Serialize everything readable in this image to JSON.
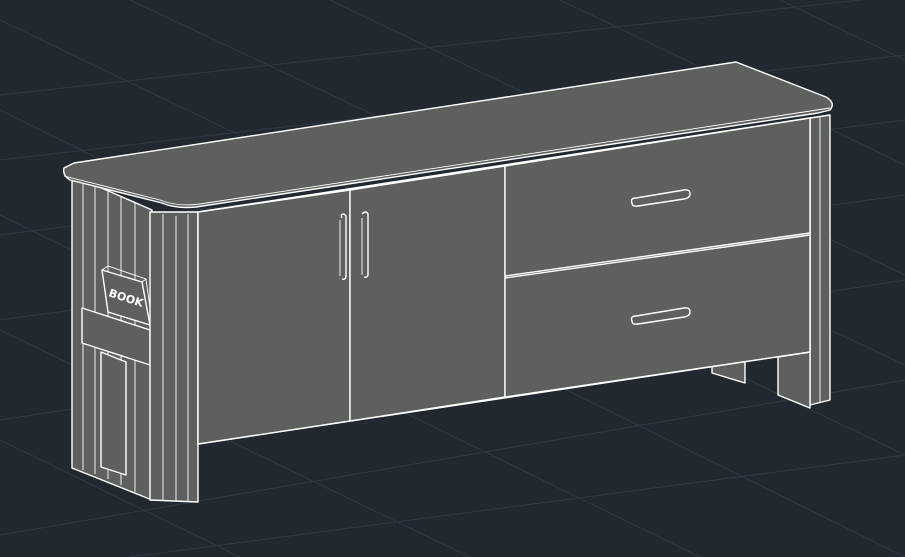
{
  "model_viewport": {
    "background_color": "#212830",
    "grid_color": "#2f3944",
    "linework_color": "#ffffff",
    "surface_color": "#5d605d",
    "object": {
      "type": "sideboard",
      "book_label": "BOOK",
      "doors": 2,
      "drawers": 2
    }
  }
}
